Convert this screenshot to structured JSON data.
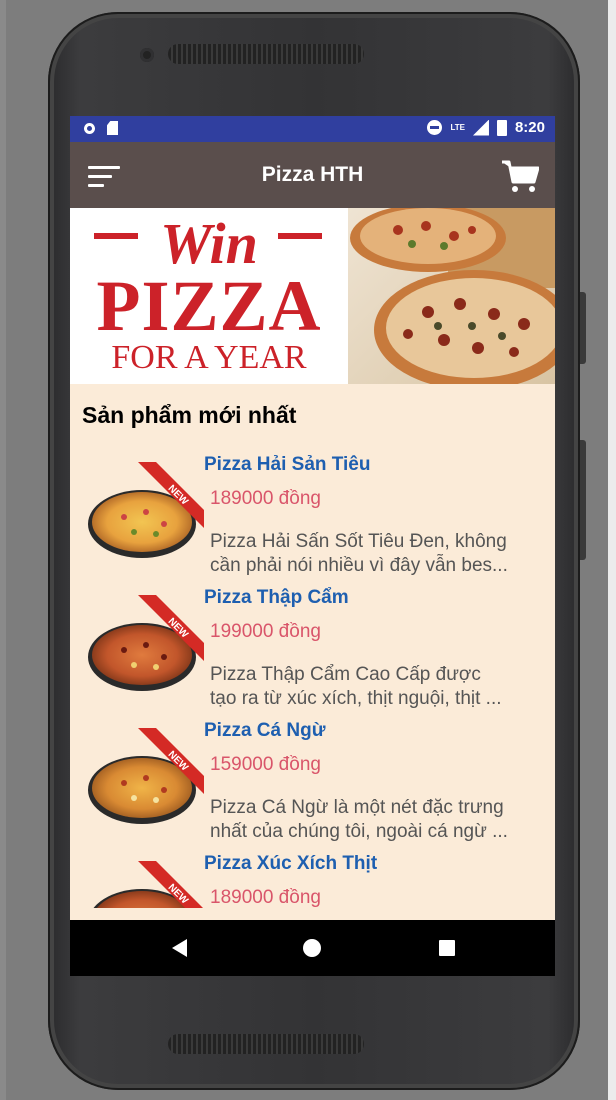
{
  "status_bar": {
    "time": "8:20",
    "lte_label": "LTE",
    "icons": [
      "circle-notification-icon",
      "sd-card-icon",
      "do-not-disturb-icon",
      "lte-signal-icon",
      "battery-icon"
    ]
  },
  "toolbar": {
    "title": "Pizza HTH",
    "menu_icon": "menu-icon",
    "cart_icon": "cart-icon"
  },
  "banner": {
    "line1": "Win",
    "line2": "PIZZA",
    "line3": "FOR A YEAR",
    "color": "#cc2229"
  },
  "section": {
    "title": "Sản phẩm mới nhất"
  },
  "badge_label": "NEW",
  "products": [
    {
      "name": "Pizza Hải Sản Tiêu",
      "price": "189000 đồng",
      "desc_line1": "Pizza Hải Sấn Sốt Tiêu Đen, không",
      "desc_line2": "cần phải nói nhiều vì đây vẫn bes..."
    },
    {
      "name": "Pizza Thập Cẩm",
      "price": "199000 đồng",
      "desc_line1": "Pizza Thập Cẩm Cao Cấp được",
      "desc_line2": "tạo ra từ xúc xích, thịt nguội, thịt ..."
    },
    {
      "name": "Pizza Cá Ngừ",
      "price": "159000 đồng",
      "desc_line1": "Pizza Cá Ngừ là một nét đặc trưng",
      "desc_line2": "nhất của chúng tôi, ngoài cá ngừ ..."
    },
    {
      "name": "Pizza Xúc Xích Thịt",
      "price": "189000 đồng",
      "desc_line1": "",
      "desc_line2": ""
    }
  ],
  "colors": {
    "status_bar": "#303f9f",
    "toolbar": "#5a4e4c",
    "background": "#fbebd8",
    "product_name": "#1e5fb0",
    "price": "#d9556a",
    "badge": "#d42a25"
  },
  "nav_bar": {
    "icons": [
      "back-icon",
      "home-icon",
      "recent-apps-icon"
    ]
  }
}
